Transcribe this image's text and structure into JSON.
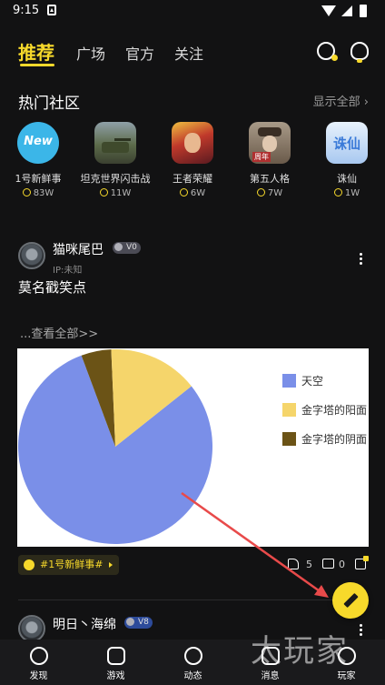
{
  "status_bar": {
    "time": "9:15"
  },
  "top_tabs": [
    {
      "label": "推荐",
      "active": true
    },
    {
      "label": "广场",
      "active": false
    },
    {
      "label": "官方",
      "active": false
    },
    {
      "label": "关注",
      "active": false
    }
  ],
  "hot_communities": {
    "title": "热门社区",
    "show_all": "显示全部 ›",
    "items": [
      {
        "name": "1号新鲜事",
        "count": "83W",
        "icon_text": "New",
        "color": "#3bb6e8"
      },
      {
        "name": "坦克世界闪击战",
        "count": "11W",
        "icon_text": "",
        "color": "#6a7a5a"
      },
      {
        "name": "王者荣耀",
        "count": "6W",
        "icon_text": "",
        "color": "#c0392b"
      },
      {
        "name": "第五人格",
        "count": "7W",
        "icon_text": "周年",
        "color": "#7d6a5a"
      },
      {
        "name": "诛仙",
        "count": "1W",
        "icon_text": "诛仙",
        "color": "#7ab0e8"
      }
    ]
  },
  "post1": {
    "author": "猫咪尾巴",
    "level": "V0",
    "ip": "IP:未知",
    "text": "莫名戳笑点",
    "view_all": "...查看全部>>",
    "topic": "#1号新鲜事#",
    "likes": "5",
    "comments": "0"
  },
  "chart_data": {
    "type": "pie",
    "title": "",
    "labels": [
      "天空",
      "金字塔的阳面",
      "金字塔的阴面"
    ],
    "values": [
      80,
      15,
      5
    ],
    "colors": [
      "#7a8fe8",
      "#f5d56b",
      "#6b5316"
    ],
    "legend": "right"
  },
  "post2": {
    "author": "明日丶海绵",
    "level": "V8"
  },
  "bottom_nav": [
    {
      "label": "发现"
    },
    {
      "label": "游戏"
    },
    {
      "label": "动态"
    },
    {
      "label": "消息"
    },
    {
      "label": "玩家"
    }
  ],
  "watermark": "太玩家",
  "colors": {
    "accent": "#f7d92b",
    "background": "#121213",
    "annotation_arrow": "#e84a4a"
  }
}
